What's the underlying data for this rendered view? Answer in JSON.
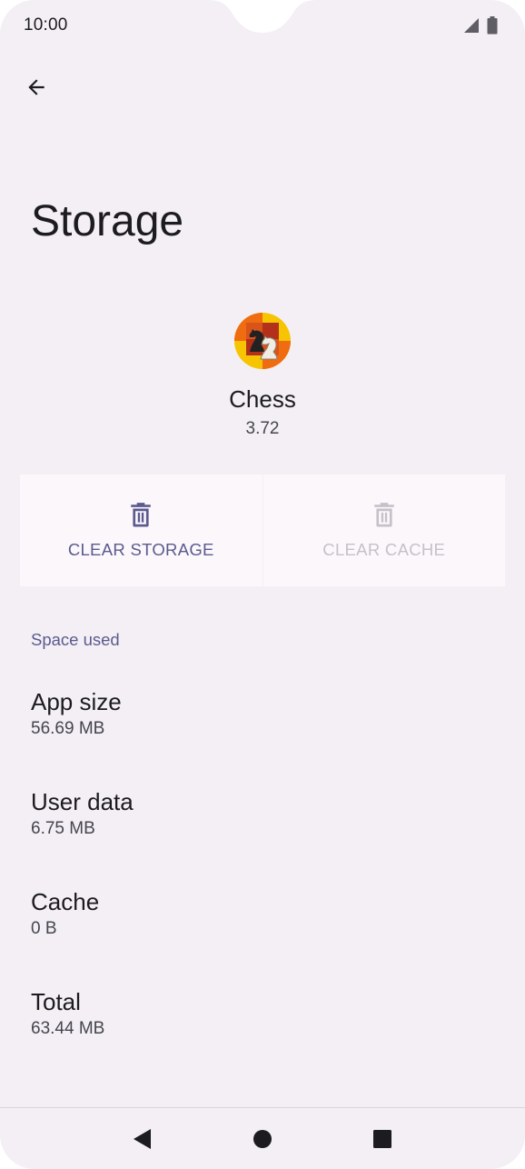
{
  "status_bar": {
    "time": "10:00",
    "icons": [
      "cellular-signal-icon",
      "battery-icon"
    ]
  },
  "toolbar": {
    "back_icon": "arrow-back-icon"
  },
  "page": {
    "title": "Storage"
  },
  "app": {
    "name": "Chess",
    "version": "3.72",
    "icon": "chess-app-icon"
  },
  "actions": [
    {
      "label": "CLEAR STORAGE",
      "icon": "trash-icon",
      "enabled": true
    },
    {
      "label": "CLEAR CACHE",
      "icon": "trash-icon",
      "enabled": false
    }
  ],
  "space_used": {
    "header": "Space used",
    "rows": [
      {
        "title": "App size",
        "value": "56.69 MB"
      },
      {
        "title": "User data",
        "value": "6.75 MB"
      },
      {
        "title": "Cache",
        "value": "0 B"
      },
      {
        "title": "Total",
        "value": "63.44 MB"
      }
    ]
  },
  "nav_bar": {
    "icons": [
      "back-triangle-icon",
      "home-circle-icon",
      "recents-square-icon"
    ]
  },
  "colors": {
    "background": "#f3eff4",
    "accent": "#5b5b8f",
    "button_surface": "#fcf7fb",
    "disabled": "#c4c2c8"
  }
}
